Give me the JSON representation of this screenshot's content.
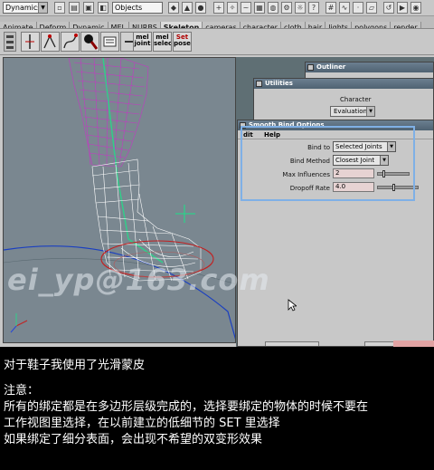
{
  "statusline": {
    "mode": "Dynamics",
    "objects_field": "Objects"
  },
  "shelf": {
    "tabs": [
      "Animate",
      "Deform",
      "Dynamic",
      "MEL",
      "NURBS",
      "Skeleton",
      "cameras",
      "character",
      "cloth",
      "hair",
      "lights",
      "polygons",
      "render"
    ],
    "active_tab": "Skeleton",
    "buttons": [
      {
        "name": "joint-tool",
        "label": ""
      },
      {
        "name": "ik-handle",
        "label": ""
      },
      {
        "name": "ik-spline",
        "label": ""
      },
      {
        "name": "paint-weights",
        "label": ""
      },
      {
        "name": "insert-joint",
        "label": ""
      },
      {
        "name": "mel-joint",
        "label": "mel\njoint"
      },
      {
        "name": "mel-select",
        "label": "mel\nselect"
      },
      {
        "name": "set-pose",
        "label": "Set\npose"
      }
    ]
  },
  "outliner": {
    "title": "Outliner"
  },
  "utilities": {
    "title": "Utilities",
    "character_label": "Character",
    "evaluation": "Evaluation"
  },
  "smooth_bind": {
    "title": "Smooth Bind Options",
    "menu": [
      "dit",
      "Help"
    ],
    "bind_to_label": "Bind to",
    "bind_to_value": "Selected Joints",
    "bind_method_label": "Bind Method",
    "bind_method_value": "Closest Joint",
    "max_influences_label": "Max Influences",
    "max_influences_value": "2",
    "max_influences_slider": 0.15,
    "dropoff_rate_label": "Dropoff Rate",
    "dropoff_rate_value": "4.0",
    "dropoff_rate_slider": 0.4
  },
  "watermark": "ei_yp@163.com",
  "caption": {
    "line1": "对于鞋子我使用了光滑蒙皮",
    "line2": "注意：",
    "line3": "所有的绑定都是在多边形层级完成的，选择要绑定的物体的时候不要在",
    "line4": "工作视图里选择，在以前建立的低细节的 SET 里选择",
    "line5": "如果绑定了细分表面，会出现不希望的双变形效果"
  },
  "colors": {
    "viewport": "#7a8790",
    "wireframe_leg": "#c040c0",
    "wireframe_shoe": "#ffffff",
    "joint": "#2fd08a",
    "highlight": "#7fb0e6"
  }
}
